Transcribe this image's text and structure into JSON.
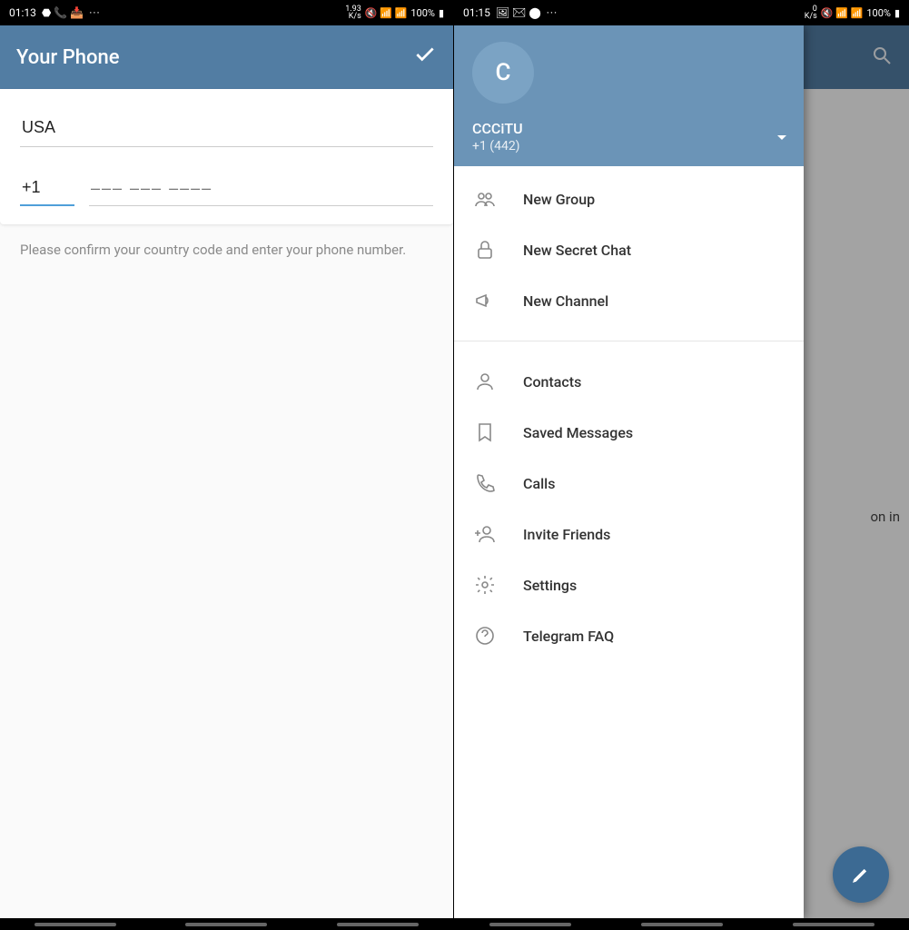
{
  "left": {
    "status": {
      "time": "01:13",
      "speed": "1.93\nK/s",
      "battery": "100%",
      "dots": "···"
    },
    "title": "Your Phone",
    "country": "USA",
    "code": "+1",
    "placeholder": "––– ––– ––––",
    "help": "Please confirm your country code and enter your phone number."
  },
  "right": {
    "status": {
      "time": "01:15",
      "speed": "0\nK/s",
      "battery": "100%",
      "dots": "···"
    },
    "avatar_letter": "C",
    "user": {
      "name": "CCCiTU",
      "phone": "+1 (442)"
    },
    "menu_group1": [
      {
        "icon": "group",
        "label": "New Group",
        "name": "menu-new-group"
      },
      {
        "icon": "lock",
        "label": "New Secret Chat",
        "name": "menu-new-secret-chat"
      },
      {
        "icon": "megaphone",
        "label": "New Channel",
        "name": "menu-new-channel"
      }
    ],
    "menu_group2": [
      {
        "icon": "person",
        "label": "Contacts",
        "name": "menu-contacts"
      },
      {
        "icon": "bookmark",
        "label": "Saved Messages",
        "name": "menu-saved-messages"
      },
      {
        "icon": "phone",
        "label": "Calls",
        "name": "menu-calls"
      },
      {
        "icon": "invite",
        "label": "Invite Friends",
        "name": "menu-invite-friends"
      },
      {
        "icon": "gear",
        "label": "Settings",
        "name": "menu-settings"
      },
      {
        "icon": "help",
        "label": "Telegram FAQ",
        "name": "menu-faq"
      }
    ],
    "background_hint": "on in"
  }
}
